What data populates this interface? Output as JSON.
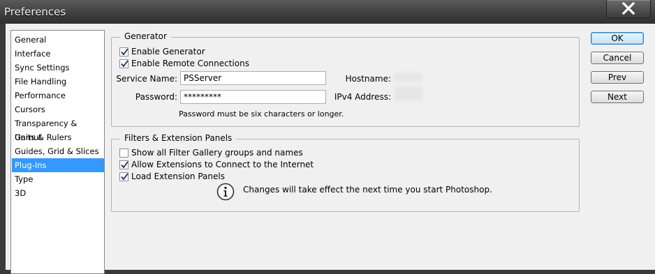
{
  "window": {
    "title": "Preferences"
  },
  "sidebar": {
    "items": [
      {
        "label": "General",
        "selected": false
      },
      {
        "label": "Interface",
        "selected": false
      },
      {
        "label": "Sync Settings",
        "selected": false
      },
      {
        "label": "File Handling",
        "selected": false
      },
      {
        "label": "Performance",
        "selected": false
      },
      {
        "label": "Cursors",
        "selected": false
      },
      {
        "label": "Transparency & Gamut",
        "selected": false
      },
      {
        "label": "Units & Rulers",
        "selected": false
      },
      {
        "label": "Guides, Grid & Slices",
        "selected": false
      },
      {
        "label": "Plug-Ins",
        "selected": true
      },
      {
        "label": "Type",
        "selected": false
      },
      {
        "label": "3D",
        "selected": false
      }
    ]
  },
  "generator": {
    "title": "Generator",
    "enable_generator": {
      "label": "Enable Generator",
      "checked": true
    },
    "enable_remote": {
      "label": "Enable Remote Connections",
      "checked": true
    },
    "service_name_label": "Service Name:",
    "service_name_value": "PSServer",
    "password_label": "Password:",
    "password_value": "*********",
    "password_hint": "Password must be six characters or longer.",
    "hostname_label": "Hostname:",
    "ipv4_label": "IPv4 Address:"
  },
  "filters": {
    "title": "Filters & Extension Panels",
    "show_filter_gallery": {
      "label": "Show all Filter Gallery groups and names",
      "checked": false
    },
    "allow_extensions": {
      "label": "Allow Extensions to Connect to the Internet",
      "checked": true
    },
    "load_panels": {
      "label": "Load Extension Panels",
      "checked": true
    },
    "note": "Changes will take effect the next time you start Photoshop.",
    "note_icon": "info-icon"
  },
  "buttons": {
    "ok": "OK",
    "cancel": "Cancel",
    "prev": "Prev",
    "next": "Next"
  },
  "colors": {
    "selection": "#3399ff",
    "default_button": "#c4e5f6",
    "titlebar": "#444444"
  }
}
